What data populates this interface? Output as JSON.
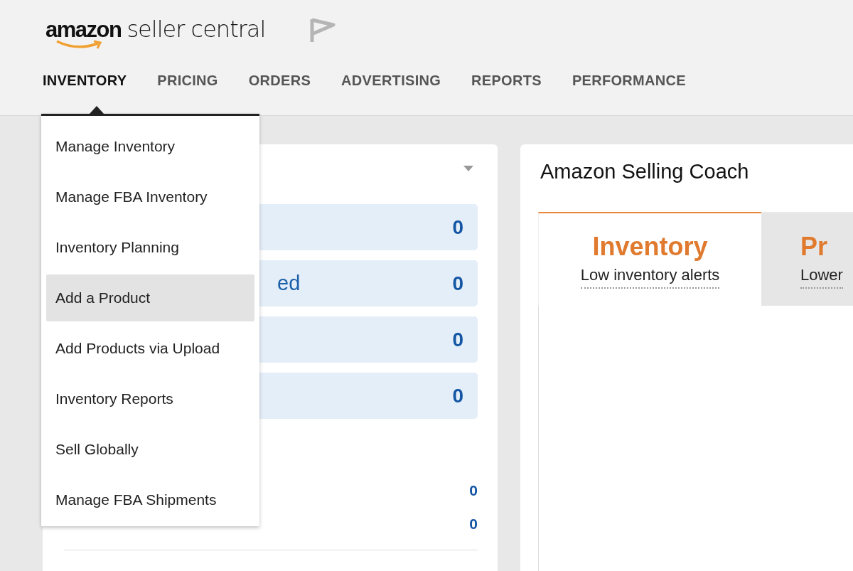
{
  "header": {
    "logo": {
      "brand": "amazon",
      "product": "seller central"
    }
  },
  "nav": [
    {
      "label": "INVENTORY",
      "selected": true
    },
    {
      "label": "PRICING",
      "selected": false
    },
    {
      "label": "ORDERS",
      "selected": false
    },
    {
      "label": "ADVERTISING",
      "selected": false
    },
    {
      "label": "REPORTS",
      "selected": false
    },
    {
      "label": "PERFORMANCE",
      "selected": false
    }
  ],
  "menu": {
    "items": [
      {
        "label": "Manage Inventory",
        "selected": false
      },
      {
        "label": "Manage FBA Inventory",
        "selected": false
      },
      {
        "label": "Inventory Planning",
        "selected": false
      },
      {
        "label": "Add a Product",
        "selected": true
      },
      {
        "label": "Add Products via Upload",
        "selected": false
      },
      {
        "label": "Inventory Reports",
        "selected": false
      },
      {
        "label": "Sell Globally",
        "selected": false
      },
      {
        "label": "Manage FBA Shipments",
        "selected": false
      }
    ]
  },
  "summary_card": {
    "rows": [
      {
        "value": "0"
      },
      {
        "label": "ed",
        "value": "0"
      },
      {
        "value": "0"
      },
      {
        "value": "0"
      }
    ],
    "stats": [
      {
        "value": "0"
      },
      {
        "value": "0"
      }
    ]
  },
  "coach": {
    "title": "Amazon Selling Coach",
    "tabs": [
      {
        "title": "Inventory",
        "subtitle": "Low inventory alerts",
        "selected": true
      },
      {
        "title": "Pr",
        "subtitle": "Lower",
        "selected": false
      }
    ]
  }
}
